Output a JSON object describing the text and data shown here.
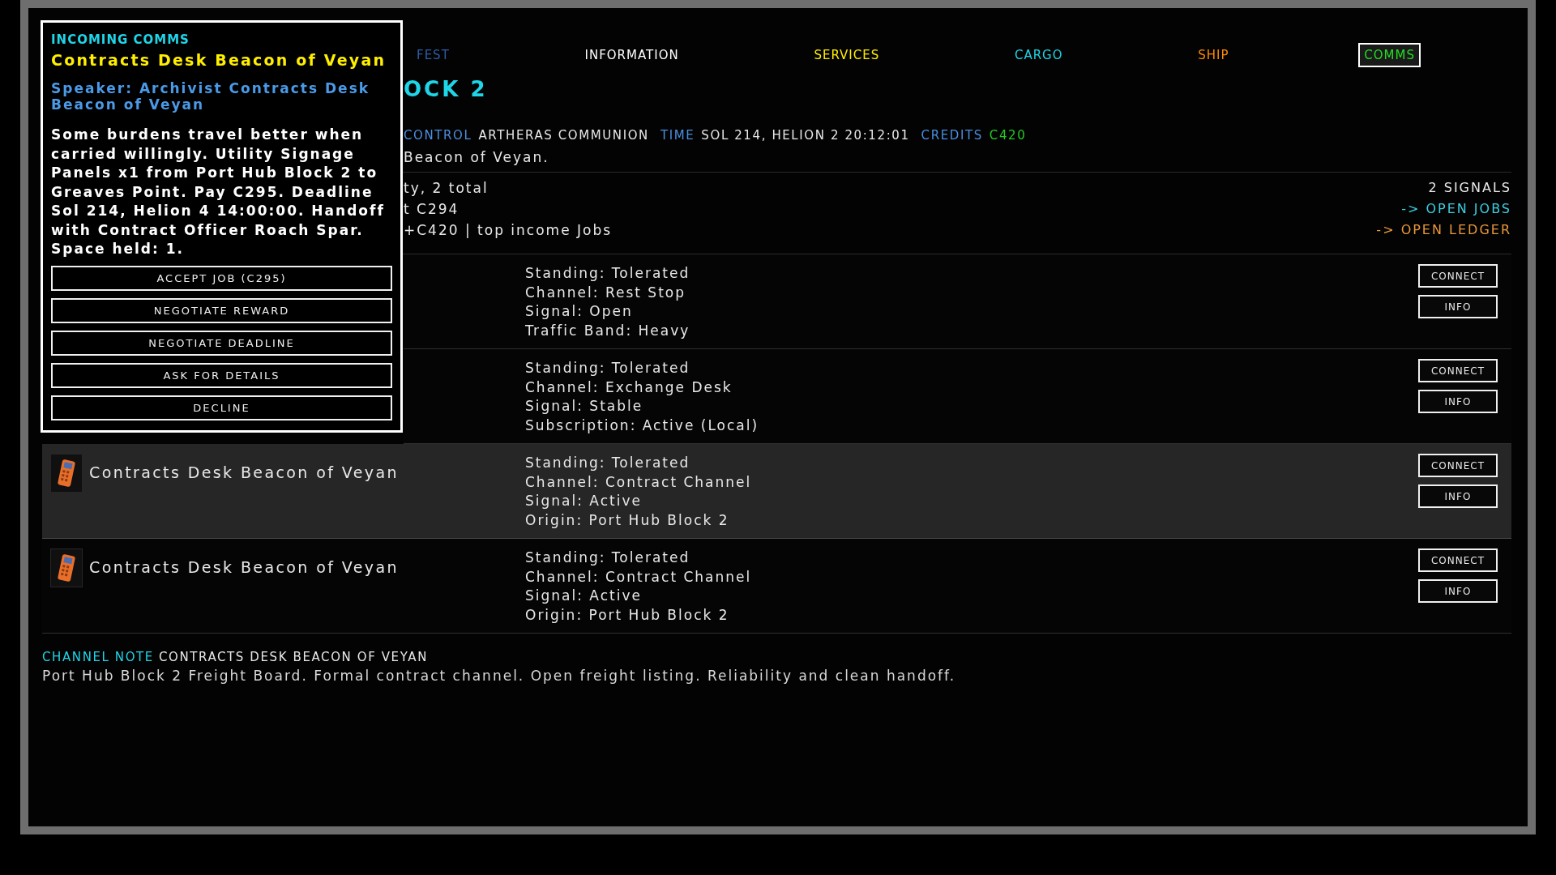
{
  "nav": [
    {
      "label": "FEST",
      "selected": false,
      "color": "#2c5fa8"
    },
    {
      "label": "INFORMATION",
      "selected": false,
      "color": "#ffffff"
    },
    {
      "label": "SERVICES",
      "selected": false,
      "color": "#ffee00"
    },
    {
      "label": "CARGO",
      "selected": false,
      "color": "#1fd5e8"
    },
    {
      "label": "SHIP",
      "selected": false,
      "color": "#ff8c00"
    },
    {
      "label": "COMMS",
      "selected": true,
      "color": "#22dd22"
    }
  ],
  "header": {
    "title": "OCK 2",
    "status": [
      {
        "label": "CONTROL",
        "value": "ARTHERAS COMMUNION",
        "kind": "text"
      },
      {
        "label": "TIME",
        "value": "SOL 214, HELION 2 20:12:01",
        "kind": "text"
      },
      {
        "label": "CREDITS",
        "value": "C420",
        "kind": "credits"
      }
    ],
    "subtitle": "Beacon of Veyan."
  },
  "summary": {
    "lines": [
      "ty, 2 total",
      "t C294",
      "+C420 | top income Jobs"
    ],
    "signals": "2 SIGNALS",
    "links": [
      {
        "label": "-> OPEN JOBS",
        "color": "#3ccfe0"
      },
      {
        "label": "-> OPEN LEDGER",
        "color": "#e8973a"
      }
    ]
  },
  "rows": [
    {
      "selected": false,
      "details": [
        "Standing: Tolerated",
        "Channel: Rest Stop",
        "Signal: Open",
        "Traffic Band: Heavy"
      ],
      "buttons": [
        "CONNECT",
        "INFO"
      ]
    },
    {
      "selected": false,
      "details": [
        "Standing: Tolerated",
        "Channel: Exchange Desk",
        "Signal: Stable",
        "Subscription: Active (Local)"
      ],
      "buttons": [
        "CONNECT",
        "INFO"
      ]
    },
    {
      "selected": true,
      "name": "Contracts Desk Beacon of Veyan",
      "details": [
        "Standing: Tolerated",
        "Channel: Contract Channel",
        "Signal: Active",
        "Origin: Port Hub Block 2"
      ],
      "buttons": [
        "CONNECT",
        "INFO"
      ]
    },
    {
      "selected": false,
      "name": "Contracts Desk Beacon of Veyan",
      "details": [
        "Standing: Tolerated",
        "Channel: Contract Channel",
        "Signal: Active",
        "Origin: Port Hub Block 2"
      ],
      "buttons": [
        "CONNECT",
        "INFO"
      ]
    }
  ],
  "note": {
    "label": "CHANNEL NOTE",
    "title": "CONTRACTS DESK BEACON OF VEYAN",
    "text": "Port Hub Block 2 Freight Board. Formal contract channel. Open freight listing. Reliability and clean handoff."
  },
  "popup": {
    "heading": "INCOMING COMMS",
    "title": "Contracts Desk Beacon of Veyan",
    "speaker": "Speaker: Archivist Contracts Desk Beacon of Veyan",
    "body": "Some burdens travel better when carried willingly. Utility Signage Panels x1 from Port Hub Block 2 to Greaves Point. Pay C295. Deadline Sol 214, Helion 4 14:00:00. Handoff with Contract Officer Roach Spar. Space held: 1.",
    "actions": [
      "ACCEPT JOB (C295)",
      "NEGOTIATE REWARD",
      "NEGOTIATE DEADLINE",
      "ASK FOR DETAILS",
      "DECLINE"
    ]
  }
}
